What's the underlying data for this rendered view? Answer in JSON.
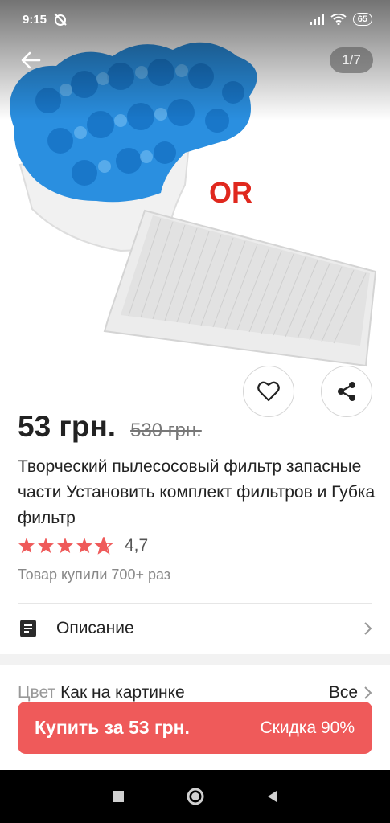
{
  "status_bar": {
    "time": "9:15",
    "battery": "65"
  },
  "gallery": {
    "counter": "1/7",
    "overlay_text": "OR"
  },
  "product": {
    "price": "53 грн.",
    "old_price": "530 грн.",
    "title": "Творческий пылесосовый фильтр запасные части Установить комплект фильтров и Губка фильтр",
    "rating": "4,7",
    "rating_stars": 4.7,
    "sold": "Товар купили 700+ раз"
  },
  "description": {
    "label": "Описание"
  },
  "options": {
    "color_label": "Цвет",
    "color_value": "Как на картинке",
    "all_label": "Все"
  },
  "buy": {
    "label": "Купить за 53 грн.",
    "discount": "Скидка 90%"
  },
  "colors": {
    "accent": "#ef5a5a",
    "star": "#ef5a5a",
    "sponge": "#2a8fe0"
  },
  "icons": [
    "back-arrow-icon",
    "heart-icon",
    "share-icon",
    "document-icon",
    "chevron-right-icon",
    "star-icon",
    "nav-square-icon",
    "nav-circle-icon",
    "nav-triangle-icon"
  ]
}
